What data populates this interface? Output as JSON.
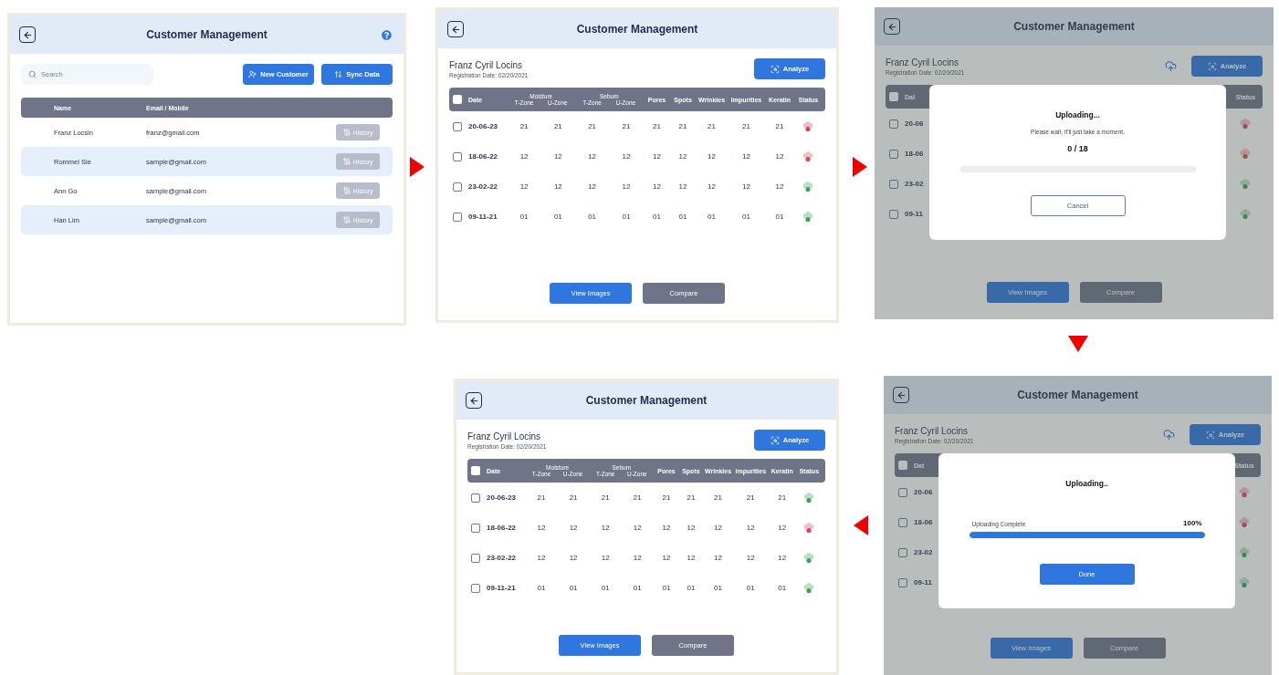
{
  "screens": [
    {
      "kind": "list",
      "title": "Customer Management",
      "search": {
        "placeholder": "Search"
      },
      "actions": [
        {
          "label": "New Customer",
          "kind": "add-user"
        },
        {
          "label": "Sync Data",
          "kind": "sync"
        }
      ],
      "table": {
        "columns": [
          "Name",
          "Email / Mobile"
        ],
        "rows": [
          {
            "name": "Franz Locsin",
            "contact": "franz@gmail.com",
            "action": "History"
          },
          {
            "name": "Rommel Sie",
            "contact": "sample@gmail.com",
            "action": "History"
          },
          {
            "name": "Ann Go",
            "contact": "sample@gmail.com",
            "action": "History"
          },
          {
            "name": "Han Lim",
            "contact": "sample@gmail.com",
            "action": "History"
          }
        ]
      }
    },
    {
      "kind": "detail",
      "title": "Customer Management",
      "customer": {
        "name": "Franz Cyril Locins",
        "registration": "Registration Date: 02/20/2021"
      },
      "analyze": "Analyze",
      "table": {
        "select_all": {
          "checked": false
        },
        "columns": [
          {
            "label": "Date",
            "kind": "date"
          },
          {
            "label": "Moisture",
            "kind": "group",
            "sub": [
              "T-Zone",
              "U-Zone"
            ]
          },
          {
            "label": "Sebum",
            "kind": "group",
            "sub": [
              "T-Zone",
              "U-Zone"
            ]
          },
          {
            "label": "Pores",
            "kind": "value"
          },
          {
            "label": "Spots",
            "kind": "value"
          },
          {
            "label": "Wrinkles",
            "kind": "value"
          },
          {
            "label": "Impurities",
            "kind": "value"
          },
          {
            "label": "Keratin",
            "kind": "value"
          },
          {
            "label": "Status",
            "kind": "status"
          }
        ],
        "rows": [
          {
            "checked": false,
            "date": "20-06-23",
            "values": [
              "21",
              "21",
              "21",
              "21",
              "21",
              "21",
              "21",
              "21",
              "21"
            ],
            "color": "#e0444f"
          },
          {
            "checked": false,
            "date": "18-06-22",
            "values": [
              "12",
              "12",
              "12",
              "12",
              "12",
              "12",
              "12",
              "12",
              "12"
            ],
            "color": "#e0444f"
          },
          {
            "checked": false,
            "date": "23-02-22",
            "values": [
              "12",
              "12",
              "12",
              "12",
              "12",
              "12",
              "12",
              "12",
              "12"
            ],
            "color": "#38a556"
          },
          {
            "checked": false,
            "date": "09-11-21",
            "values": [
              "01",
              "01",
              "01",
              "01",
              "01",
              "01",
              "01",
              "01",
              "01"
            ],
            "color": "#38a556"
          }
        ]
      },
      "buttons": [
        {
          "label": "View Images",
          "kind": "primary"
        },
        {
          "label": "Compare",
          "kind": "secondary"
        }
      ]
    },
    {
      "kind": "uploading",
      "title": "Customer Management",
      "customer": {
        "name": "Franz Cyril Locins",
        "registration": "Registration Date: 02/20/2021"
      },
      "analyze": "Analyze",
      "table": {
        "select_all": {
          "checked": false
        },
        "columns": [
          {
            "label": "Dat",
            "kind": "date"
          },
          {
            "label": "Status",
            "kind": "status"
          }
        ],
        "rows": [
          {
            "checked": false,
            "date": "20-06",
            "color": "#a64a50"
          },
          {
            "checked": false,
            "date": "18-06",
            "color": "#a64a50"
          },
          {
            "checked": false,
            "date": "23-02",
            "color": "#3e8654"
          },
          {
            "checked": false,
            "date": "09-11",
            "color": "#3e8654"
          }
        ]
      },
      "buttons": [
        {
          "label": "View Images",
          "kind": "primary"
        },
        {
          "label": "Compare",
          "kind": "secondary"
        }
      ],
      "modal": {
        "title": "Uploading...",
        "message": "Please wait, it'll just take a moment.",
        "count": "0 / 18",
        "level": 0,
        "button": {
          "label": "Cancel",
          "kind": "outline"
        }
      }
    },
    {
      "kind": "detail",
      "title": "Customer Management",
      "customer": {
        "name": "Franz Cyril Locins",
        "registration": "Registration Date: 02/20/2021"
      },
      "analyze": "Analyze",
      "table": {
        "select_all": {
          "checked": false
        },
        "columns": [
          {
            "label": "Date",
            "kind": "date"
          },
          {
            "label": "Moisture",
            "kind": "group",
            "sub": [
              "T-Zone",
              "U-Zone"
            ]
          },
          {
            "label": "Sebum",
            "kind": "group",
            "sub": [
              "T-Zone",
              "U-Zone"
            ]
          },
          {
            "label": "Pores",
            "kind": "value"
          },
          {
            "label": "Spots",
            "kind": "value"
          },
          {
            "label": "Wrinkles",
            "kind": "value"
          },
          {
            "label": "Impurities",
            "kind": "value"
          },
          {
            "label": "Keratin",
            "kind": "value"
          },
          {
            "label": "Status",
            "kind": "status"
          }
        ],
        "rows": [
          {
            "checked": false,
            "date": "20-06-23",
            "values": [
              "21",
              "21",
              "21",
              "21",
              "21",
              "21",
              "21",
              "21",
              "21"
            ],
            "color": "#38a556"
          },
          {
            "checked": false,
            "date": "18-06-22",
            "values": [
              "12",
              "12",
              "12",
              "12",
              "12",
              "12",
              "12",
              "12",
              "12"
            ],
            "color": "#e0444f"
          },
          {
            "checked": false,
            "date": "23-02-22",
            "values": [
              "12",
              "12",
              "12",
              "12",
              "12",
              "12",
              "12",
              "12",
              "12"
            ],
            "color": "#38a556"
          },
          {
            "checked": false,
            "date": "09-11-21",
            "values": [
              "01",
              "01",
              "01",
              "01",
              "01",
              "01",
              "01",
              "01",
              "01"
            ],
            "color": "#38a556"
          }
        ]
      },
      "buttons": [
        {
          "label": "View Images",
          "kind": "primary"
        },
        {
          "label": "Compare",
          "kind": "secondary"
        }
      ]
    },
    {
      "kind": "uploading",
      "title": "Customer Management",
      "customer": {
        "name": "Franz Cyril Locins",
        "registration": "Registration Date: 02/20/2021"
      },
      "analyze": "Analyze",
      "table": {
        "select_all": {
          "checked": false
        },
        "columns": [
          {
            "label": "Dat",
            "kind": "date"
          },
          {
            "label": "Status",
            "kind": "status"
          }
        ],
        "rows": [
          {
            "checked": false,
            "date": "20-06",
            "color": "#a64a50"
          },
          {
            "checked": false,
            "date": "18-06",
            "color": "#a64a50"
          },
          {
            "checked": false,
            "date": "23-02",
            "color": "#3e8654"
          },
          {
            "checked": false,
            "date": "09-11",
            "color": "#3e8654"
          }
        ]
      },
      "buttons": [
        {
          "label": "View Images",
          "kind": "primary"
        },
        {
          "label": "Compare",
          "kind": "secondary"
        }
      ],
      "modal": {
        "title": "Uploading..",
        "progress_label": "Uploading Complete",
        "percent": "100%",
        "level": 1,
        "button": {
          "label": "Done",
          "kind": "primary"
        }
      }
    }
  ]
}
